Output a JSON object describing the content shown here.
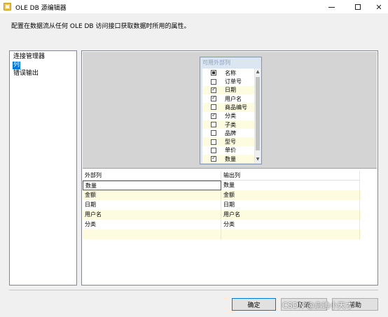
{
  "window": {
    "title": "OLE DB 源编辑器",
    "minimize": "—",
    "close": "✕"
  },
  "description": "配置在数据流从任何 OLE DB 访问接口获取数据时所用的属性。",
  "nav": {
    "items": [
      {
        "label": "连接管理器",
        "selected": false
      },
      {
        "label": "列",
        "selected": true
      },
      {
        "label": "错误输出",
        "selected": false
      }
    ]
  },
  "available_columns": {
    "title": "可用外部列",
    "rows": [
      {
        "label": "名称",
        "state": "mixed"
      },
      {
        "label": "订单号",
        "state": "unchecked"
      },
      {
        "label": "日期",
        "state": "checked"
      },
      {
        "label": "用户名",
        "state": "checked"
      },
      {
        "label": "商品编号",
        "state": "unchecked"
      },
      {
        "label": "分类",
        "state": "checked"
      },
      {
        "label": "子类",
        "state": "unchecked"
      },
      {
        "label": "品牌",
        "state": "unchecked"
      },
      {
        "label": "型号",
        "state": "unchecked"
      },
      {
        "label": "单价",
        "state": "unchecked"
      },
      {
        "label": "数量",
        "state": "checked"
      }
    ]
  },
  "mapping": {
    "headers": {
      "external": "外部列",
      "output": "输出列"
    },
    "rows": [
      {
        "external": "数量",
        "output": "数量"
      },
      {
        "external": "金额",
        "output": "金额"
      },
      {
        "external": "日期",
        "output": "日期"
      },
      {
        "external": "用户名",
        "output": "用户名"
      },
      {
        "external": "分类",
        "output": "分类"
      },
      {
        "external": "",
        "output": ""
      }
    ]
  },
  "buttons": {
    "ok": "确定",
    "cancel": "取消",
    "help": "帮助"
  },
  "watermark": "CSDN @启迪小天才"
}
